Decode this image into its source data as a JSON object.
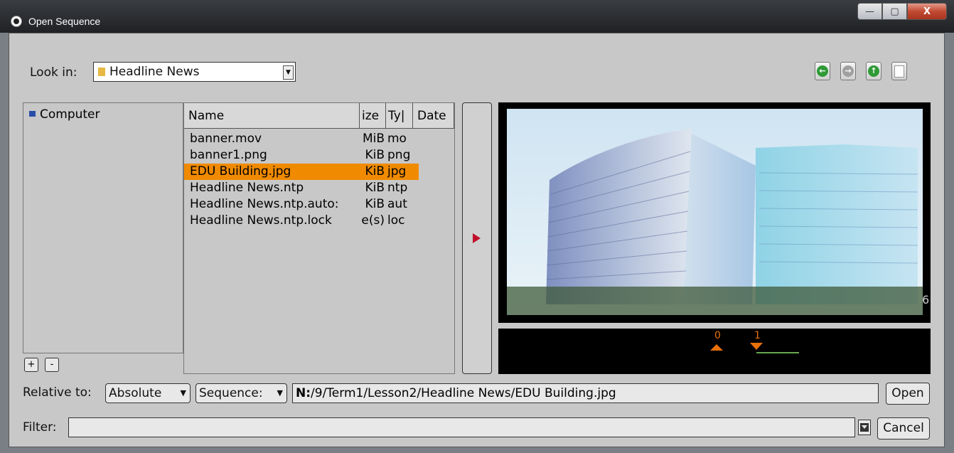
{
  "window": {
    "title": "Open Sequence",
    "controls": {
      "minimize": "—",
      "maximize": "▢",
      "close": "X"
    }
  },
  "lookin": {
    "label": "Look in:",
    "value": "Headline News"
  },
  "nav": {
    "back": "←",
    "forward": "→",
    "up": "↑",
    "new_folder": ""
  },
  "tree": {
    "items": [
      {
        "label": "Computer",
        "icon": "computer-icon"
      }
    ],
    "add": "+",
    "remove": "-"
  },
  "files": {
    "columns": [
      "Name",
      "ize",
      "Ty|",
      "Date"
    ],
    "rows": [
      {
        "name": "banner.mov",
        "size": "MiB",
        "type": "mo"
      },
      {
        "name": "banner1.png",
        "size": "KiB",
        "type": "png"
      },
      {
        "name": "EDU Building.jpg",
        "size": "KiB",
        "type": "jpg",
        "selected": true
      },
      {
        "name": "Headline News.ntp",
        "size": "KiB",
        "type": "ntp"
      },
      {
        "name": "Headline News.ntp.auto:",
        "size": "KiB",
        "type": "aut"
      },
      {
        "name": "Headline News.ntp.lock",
        "size": "e(s)",
        "type": "loc"
      }
    ]
  },
  "preview": {
    "frame_label": "6",
    "timeline_start": "0",
    "timeline_end": "1"
  },
  "relative": {
    "label": "Relative to:",
    "mode": "Absolute",
    "sequence": "Sequence:",
    "path_drive": "N:",
    "path_rest": "/9/Term1/Lesson2/Headline News/EDU Building.jpg"
  },
  "buttons": {
    "open": "Open",
    "cancel": "Cancel"
  },
  "filter": {
    "label": "Filter:",
    "value": ""
  },
  "colors": {
    "selection": "#f08a00",
    "accent_marker": "#e8700a",
    "timeline_line": "#6aa84f"
  }
}
